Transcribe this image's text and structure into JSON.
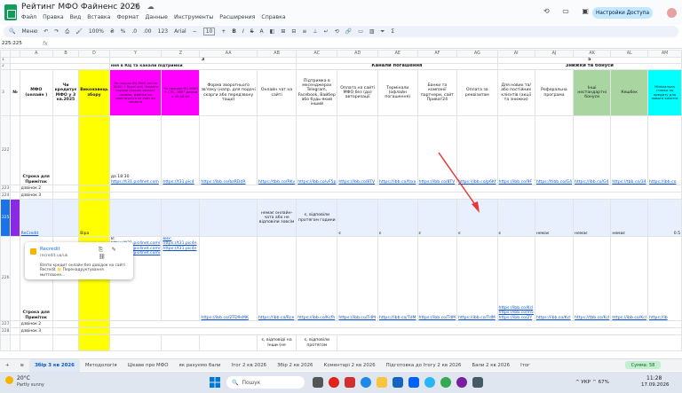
{
  "app": {
    "doc_title": "Рейтинг МФО Файненс 2026",
    "menu": [
      "Файл",
      "Правка",
      "Вид",
      "Вставка",
      "Формат",
      "Данные",
      "Инструменты",
      "Расширения",
      "Справка"
    ],
    "share_label": "Настройки Доступа"
  },
  "toolbar": {
    "search_label": "Меню",
    "zoom": "100%",
    "currency": "₴",
    "percent": "%",
    "dec1": ".0",
    "dec2": ".00",
    "numfmt": "123",
    "font": "Arial",
    "font_size": "10"
  },
  "formula_bar": {
    "name_box": "225:225",
    "fx": "fx"
  },
  "grid": {
    "col_letters": [
      "",
      "A",
      "B",
      "C",
      "D",
      "Y",
      "Z",
      "AA",
      "AB",
      "AC",
      "AD",
      "AE",
      "AF",
      "AG",
      "AI",
      "AJ",
      "AK",
      "AL",
      "AM"
    ],
    "row_header_labels": [
      "1",
      "2",
      "3",
      "",
      "222",
      "223",
      "224",
      "",
      "225",
      "",
      "226",
      "",
      "227",
      "228"
    ],
    "section_3": "3",
    "section_4_label": "Канали погашення",
    "section_5": "5",
    "section_bonus": "Знижки та бонуси",
    "section_y_header": "ння в КЦ та канали підтримки",
    "headers": {
      "n": "№",
      "mfo": "МФО (онлайн )",
      "credit": "Чи кредитує МФО у 3 кв.2025",
      "winner": "Виконавець збору",
      "y": "На першої КЦ МФО (після 18:00 + будні дні) Чекайте поради працює вихідні, ночами, дзвінки чи реєструєтся на сайт ви чекаєте",
      "z": "Чи працює КЦ МФО + СТС, 365° днями з 09-18:00",
      "aa": "Форма зворотнього зв'язку (напр. для подачі скарги або передзвону тощо)",
      "ab": "Онлайн чат на сайті",
      "ac": "Підтримка в месенджерах Telegram, Facebook, Вайбер або будь-який інший",
      "ad": "Оплата на сайті МФО без (до) авторизації",
      "ae": "Термінали (офлайн погашення)",
      "af": "Банки та компанії партнери, сайт Приват24",
      "ag": "Оплата за реквізитам",
      "ai": "Для нових та/або постійних клієнтів (акції та знижки)",
      "aj": "Реферальна програма",
      "ak": "Інші нестандартні бонуси",
      "al": "Кешбек",
      "am": "Мінімальна ставка по кредиту для нового клієнта"
    },
    "rows": {
      "r222_label": "Строка для Приміток",
      "r222_y": "да 18:30",
      "r222_aa": "https://t31.pic4net.com/",
      "r222_ab": "https://tbb.co/RKv",
      "r222_ac": "https://ibb.co/vF5p",
      "r222_ad": "https://ibb.co/8TV",
      "r222_ae": "https://ibb.co/fzxx",
      "r222_af": "https://ibb.co/8TV",
      "r222_ag": "https://ibb.co/p6Kf",
      "r222_ai": "https://ibb.co/9F",
      "r222_aj": "https://tibb.co/G4",
      "r222_ak": "https://ibb.co/G4",
      "r222_al": "https://tbb.co/34",
      "r222_am": "https://ibb.co",
      "r222_y2": "https://t31.pic4net.com",
      "r222_z": "https://t31.pic4",
      "r222_aa2": "https://ibb.co/bzRDdR",
      "r223_label": "дзвінок 2",
      "r224_label": "дзвінок 3",
      "r225_mfo": "ReCredit",
      "r225_winner": "Віра",
      "r225_ab": "немає онлайн-чата або не відповіли зовсім",
      "r225_ac": "є, відповіли протягом години",
      "r225_ad": "є",
      "r225_ae": "є",
      "r225_af": "є",
      "r225_ag": "є",
      "r225_ai": "є",
      "r225_aj": "немає",
      "r225_ak": "немає",
      "r225_al": "немає",
      "r225_am": "0.5",
      "r226_y": "8:",
      "r226_y_links": "https://t31.pic4net.com/ https://t31.pic4net.com/ https://t31.pic4net.com/",
      "r226_z": "вих: https://t31.pic4n https://t31.pic4n",
      "r226_label": "Строка для Приміток",
      "r226_aa": "https://ibb.co/2TD9sMK",
      "r226_ab": "https://ibb.co/Rce",
      "r226_ac": "https://ibb.co/Kcfh",
      "r226_ad": "https://ibb.co/TdM",
      "r226_ae": "https://ibb.co/TdM",
      "r226_af": "https://ibb.co/TdM",
      "r226_ag": "https://ibb.co/TdM",
      "r226_ai": "https://ibb.co/Kcl https://ibb.co/m5 https://ibb.co/2Y",
      "r226_aj": "https://ibb.co/Kcl",
      "r226_ak": "https://tbb.co/Kcl",
      "r226_al": "https://ibb.co/Kcl",
      "r226_am": "https://ib",
      "r227_label": "дзвінок 2",
      "r228_label": "дзвінок 3",
      "r228_ab": "є, відповіді на",
      "r228_ac": "є, відповіли",
      "r228_ab2": "Інши (не",
      "r228_ac2": "протягом"
    }
  },
  "popup": {
    "title": "Recredit",
    "url": "recredit.ua/uk",
    "description": "Взяти кредит онлайн без довідок на сайті Recredit 🌟 Перенадруктування миттєвоне..."
  },
  "sheet_tabs": [
    "+",
    "≡",
    "Збір 3 кв 2026",
    "Методологія",
    "Цікаве про МФО",
    "як рахуємо бали",
    "Ітог 2 кв 2026",
    "Збір 2 кв 2026",
    "Коментарі 2 кв 2026",
    "Підготовка до Ітогу 2 кв 2026",
    "Бали 2 кв 2026",
    "Ітог"
  ],
  "sum_chip": "Сумма: 58",
  "taskbar": {
    "temp": "20°C",
    "weather": "Partly sunny",
    "search_placeholder": "Пошук",
    "tray_lang": "УКР",
    "battery": "67%",
    "time": "11:28",
    "date": "17.09.2026"
  },
  "colors": {
    "yellow": "#ffff00",
    "magenta": "#ff00ff",
    "green": "#a8d5a0",
    "cyan": "#00ffff",
    "arrow": "#e53935"
  }
}
